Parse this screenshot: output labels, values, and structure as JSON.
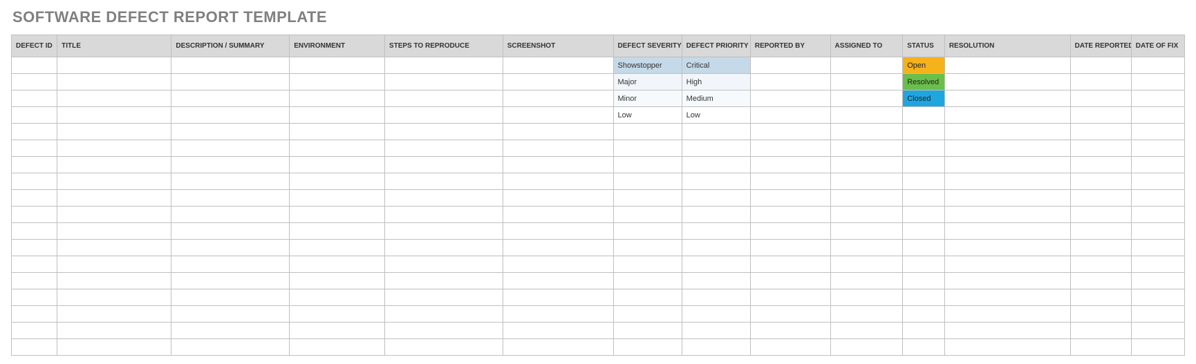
{
  "title": "SOFTWARE DEFECT REPORT TEMPLATE",
  "columns": [
    "DEFECT ID",
    "TITLE",
    "DESCRIPTION / SUMMARY",
    "ENVIRONMENT",
    "STEPS TO REPRODUCE",
    "SCREENSHOT",
    "DEFECT SEVERITY",
    "DEFECT PRIORITY",
    "REPORTED BY",
    "ASSIGNED TO",
    "STATUS",
    "RESOLUTION",
    "DATE REPORTED",
    "DATE OF FIX"
  ],
  "rows": [
    {
      "severity": "Showstopper",
      "severity_class": "sev-1",
      "priority": "Critical",
      "priority_class": "pri-1",
      "status": "Open",
      "status_class": "st-open"
    },
    {
      "severity": "Major",
      "severity_class": "sev-2",
      "priority": "High",
      "priority_class": "pri-2",
      "status": "Resolved",
      "status_class": "st-resolved"
    },
    {
      "severity": "Minor",
      "severity_class": "sev-3",
      "priority": "Medium",
      "priority_class": "pri-3",
      "status": "Closed",
      "status_class": "st-closed"
    },
    {
      "severity": "Low",
      "severity_class": "sev-4",
      "priority": "Low",
      "priority_class": "pri-4",
      "status": "",
      "status_class": ""
    },
    {},
    {},
    {},
    {},
    {},
    {},
    {},
    {},
    {},
    {},
    {},
    {},
    {},
    {}
  ]
}
